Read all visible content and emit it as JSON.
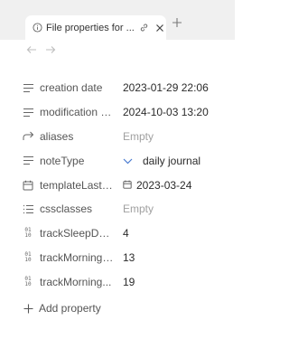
{
  "tab": {
    "title": "File properties for ...",
    "icon": "info-icon",
    "link_icon": "link-icon",
    "close_icon": "close-icon"
  },
  "new_tab_icon": "plus-icon",
  "nav": {
    "back_icon": "arrow-left-icon",
    "forward_icon": "arrow-right-icon"
  },
  "properties": [
    {
      "icon": "text-lines-icon",
      "key": "creation date",
      "value": "2023-01-29 22:06"
    },
    {
      "icon": "text-lines-icon",
      "key": "modification d...",
      "value": "2024-10-03 13:20"
    },
    {
      "icon": "alias-arrow-icon",
      "key": "aliases",
      "value": "Empty"
    },
    {
      "icon": "text-lines-icon",
      "key": "noteType",
      "value": "daily journal"
    },
    {
      "icon": "calendar-icon",
      "key": "templateLastU...",
      "value": "2023-03-24"
    },
    {
      "icon": "list-icon",
      "key": "cssclasses",
      "value": "Empty"
    },
    {
      "icon": "number-icon",
      "key": "trackSleepDur...",
      "value": "4"
    },
    {
      "icon": "number-icon",
      "key": "trackMorningE...",
      "value": "13"
    },
    {
      "icon": "number-icon",
      "key": "trackMorning...",
      "value": "19"
    }
  ],
  "number_icon_text": {
    "top": "01",
    "bottom": "10"
  },
  "add_property": {
    "label": "Add property",
    "icon": "plus-icon"
  }
}
